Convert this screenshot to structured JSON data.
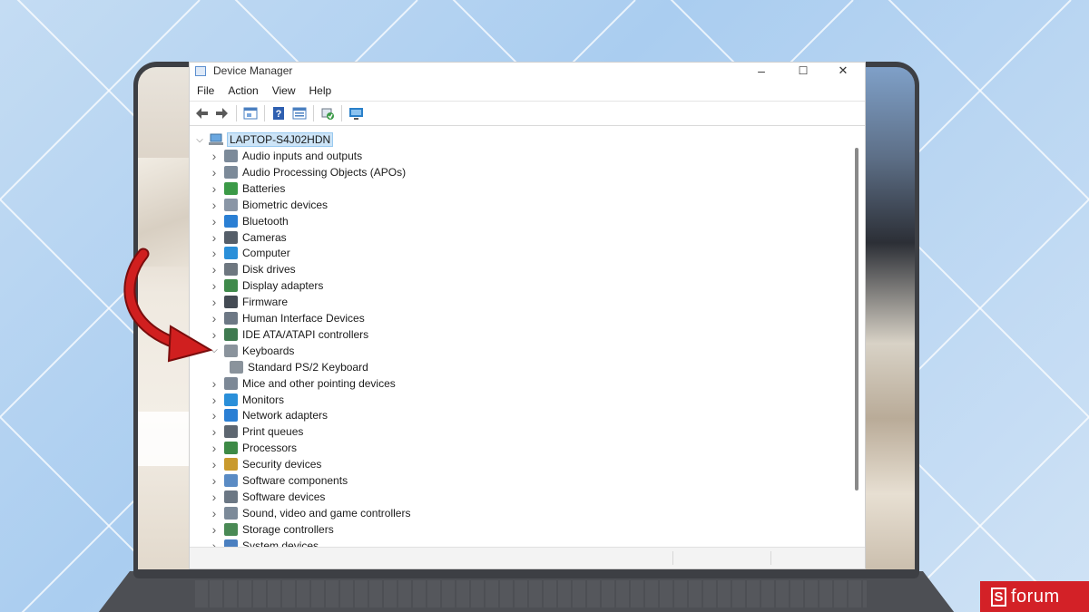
{
  "window": {
    "title": "Device Manager",
    "controls": {
      "minimize": "–",
      "maximize": "☐",
      "close": "✕"
    }
  },
  "menu": [
    "File",
    "Action",
    "View",
    "Help"
  ],
  "toolbar": [
    {
      "icon": "back-arrow-icon",
      "color": "#5a5a5a"
    },
    {
      "icon": "forward-arrow-icon",
      "color": "#5a5a5a"
    },
    {
      "icon": "properties-icon",
      "color": "#4a7fc0"
    },
    {
      "icon": "help-icon",
      "color": "#2e5fb0"
    },
    {
      "icon": "list-view-icon",
      "color": "#4a7fc0"
    },
    {
      "icon": "scan-hardware-icon",
      "color": "#3b9a47"
    },
    {
      "icon": "monitor-icon",
      "color": "#2a80c9"
    }
  ],
  "tree": {
    "root": "LAPTOP-S4J02HDN",
    "items": [
      {
        "label": "Audio inputs and outputs",
        "icon": "speaker-icon",
        "color": "#7c8a99",
        "expanded": false
      },
      {
        "label": "Audio Processing Objects (APOs)",
        "icon": "speaker-icon",
        "color": "#7c8a99",
        "expanded": false
      },
      {
        "label": "Batteries",
        "icon": "battery-icon",
        "color": "#3b9a47",
        "expanded": false
      },
      {
        "label": "Biometric devices",
        "icon": "fingerprint-icon",
        "color": "#8a96a6",
        "expanded": false
      },
      {
        "label": "Bluetooth",
        "icon": "bluetooth-icon",
        "color": "#2a7fd4",
        "expanded": false
      },
      {
        "label": "Cameras",
        "icon": "camera-icon",
        "color": "#555e69",
        "expanded": false
      },
      {
        "label": "Computer",
        "icon": "computer-icon",
        "color": "#2a8fd9",
        "expanded": false
      },
      {
        "label": "Disk drives",
        "icon": "disk-icon",
        "color": "#6e7780",
        "expanded": false
      },
      {
        "label": "Display adapters",
        "icon": "display-adapter-icon",
        "color": "#3f8a4b",
        "expanded": false
      },
      {
        "label": "Firmware",
        "icon": "firmware-icon",
        "color": "#444b54",
        "expanded": false
      },
      {
        "label": "Human Interface Devices",
        "icon": "hid-icon",
        "color": "#6d7885",
        "expanded": false
      },
      {
        "label": "IDE ATA/ATAPI controllers",
        "icon": "ide-controller-icon",
        "color": "#3f7a50",
        "expanded": false
      },
      {
        "label": "Keyboards",
        "icon": "keyboard-icon",
        "color": "#8a939c",
        "expanded": true
      },
      {
        "label": "Standard PS/2 Keyboard",
        "icon": "keyboard-icon",
        "color": "#8a939c",
        "child": true
      },
      {
        "label": "Mice and other pointing devices",
        "icon": "mouse-icon",
        "color": "#7c8896",
        "expanded": false
      },
      {
        "label": "Monitors",
        "icon": "monitor-icon",
        "color": "#2a8fd9",
        "expanded": false
      },
      {
        "label": "Network adapters",
        "icon": "network-icon",
        "color": "#2a7fd4",
        "expanded": false
      },
      {
        "label": "Print queues",
        "icon": "printer-icon",
        "color": "#5d6670",
        "expanded": false
      },
      {
        "label": "Processors",
        "icon": "processor-icon",
        "color": "#3d8a46",
        "expanded": false
      },
      {
        "label": "Security devices",
        "icon": "security-key-icon",
        "color": "#c99a2e",
        "expanded": false
      },
      {
        "label": "Software components",
        "icon": "software-component-icon",
        "color": "#5a8bc4",
        "expanded": false
      },
      {
        "label": "Software devices",
        "icon": "software-device-icon",
        "color": "#6b7784",
        "expanded": false
      },
      {
        "label": "Sound, video and game controllers",
        "icon": "speaker-icon",
        "color": "#7c8a99",
        "expanded": false
      },
      {
        "label": "Storage controllers",
        "icon": "storage-controller-icon",
        "color": "#4a8a55",
        "expanded": false
      },
      {
        "label": "System devices",
        "icon": "system-device-icon",
        "color": "#4a7fc0",
        "expanded": false
      }
    ]
  },
  "badge": {
    "letter": "S",
    "text": "forum"
  },
  "colors": {
    "accent_arrow": "#d01f1f",
    "badge_bg": "#d32127",
    "selection": "#cce4f7"
  }
}
